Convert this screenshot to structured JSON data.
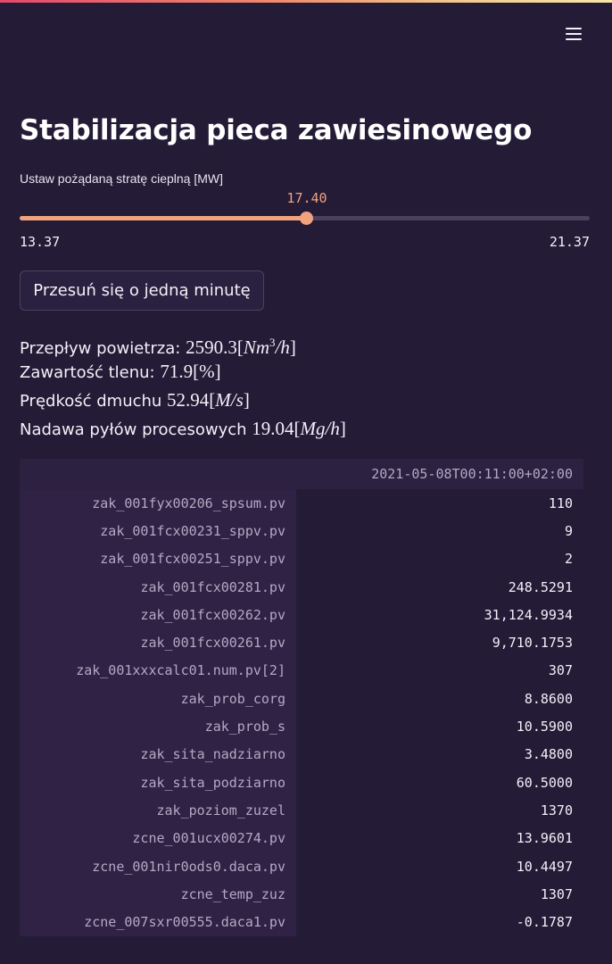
{
  "app": {
    "title": "Stabilizacja pieca zawiesinowego",
    "accent_color": "#f2a27f",
    "background_color": "#241b36"
  },
  "menu": {
    "icon": "hamburger-menu-icon"
  },
  "slider": {
    "label": "Ustaw pożądaną stratę cieplną [MW]",
    "value": "17.40",
    "min": "13.37",
    "max": "21.37",
    "fraction": 0.504
  },
  "button": {
    "label": "Przesuń się o jedną minutę"
  },
  "metrics": [
    {
      "label": "Przepływ powietrza:",
      "value": "2590.3",
      "unit_open": "[",
      "unit": "Nm",
      "unit_sup": "3",
      "unit_rest": "/h",
      "unit_close": "]"
    },
    {
      "label": "Zawartość tlenu:",
      "value": "71.9",
      "unit_open": "[",
      "unit": "%",
      "unit_sup": "",
      "unit_rest": "",
      "unit_close": "]"
    },
    {
      "label": "Prędkość dmuchu",
      "value": "52.94",
      "unit_open": "[",
      "unit": "M",
      "unit_sup": "",
      "unit_rest": "/s",
      "unit_close": "]"
    },
    {
      "label": "Nadawa pyłów procesowych",
      "value": "19.04",
      "unit_open": "[",
      "unit": "Mg",
      "unit_sup": "",
      "unit_rest": "/h",
      "unit_close": "]"
    }
  ],
  "table": {
    "column_header": "2021-05-08T00:11:00+02:00",
    "rows": [
      {
        "name": "zak_001fyx00206_spsum.pv",
        "value": "110"
      },
      {
        "name": "zak_001fcx00231_sppv.pv",
        "value": "9"
      },
      {
        "name": "zak_001fcx00251_sppv.pv",
        "value": "2"
      },
      {
        "name": "zak_001fcx00281.pv",
        "value": "248.5291"
      },
      {
        "name": "zak_001fcx00262.pv",
        "value": "31,124.9934"
      },
      {
        "name": "zak_001fcx00261.pv",
        "value": "9,710.1753"
      },
      {
        "name": "zak_001xxxcalc01.num.pv[2]",
        "value": "307"
      },
      {
        "name": "zak_prob_corg",
        "value": "8.8600"
      },
      {
        "name": "zak_prob_s",
        "value": "10.5900"
      },
      {
        "name": "zak_sita_nadziarno",
        "value": "3.4800"
      },
      {
        "name": "zak_sita_podziarno",
        "value": "60.5000"
      },
      {
        "name": "zak_poziom_zuzel",
        "value": "1370"
      },
      {
        "name": "zcne_001ucx00274.pv",
        "value": "13.9601"
      },
      {
        "name": "zcne_001nir0ods0.daca.pv",
        "value": "10.4497"
      },
      {
        "name": "zcne_temp_zuz",
        "value": "1307"
      },
      {
        "name": "zcne_007sxr00555.daca1.pv",
        "value": "-0.1787"
      }
    ]
  }
}
